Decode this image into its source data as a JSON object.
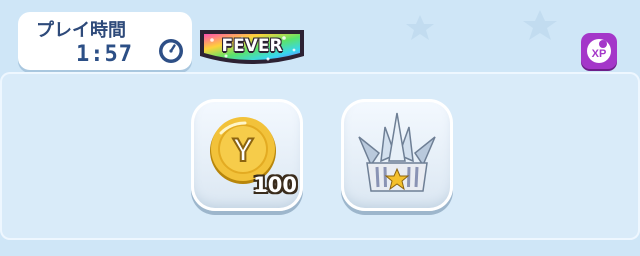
{
  "timer": {
    "label": "プレイ時間",
    "value": "1:57",
    "icon": "stopwatch-icon"
  },
  "fever": {
    "label": "FEVER",
    "colors": [
      "#ff4fb0",
      "#ffd23a",
      "#37d6f2",
      "#8b5cf6",
      "#5be36a"
    ]
  },
  "xp_button": {
    "label": "XP",
    "icon": "xp-bubble-icon",
    "color": "#a437c9"
  },
  "rewards": [
    {
      "name": "Yコイン",
      "icon": "y-coin-icon",
      "letter": "Y",
      "count": "100"
    },
    {
      "name": "crown",
      "icon": "crystal-crown-icon"
    }
  ],
  "colors": {
    "background": "#cfe6f7",
    "panel": "#d9ebf9",
    "coin_gold": "#f2c23a",
    "timer_text": "#2c4f86"
  }
}
